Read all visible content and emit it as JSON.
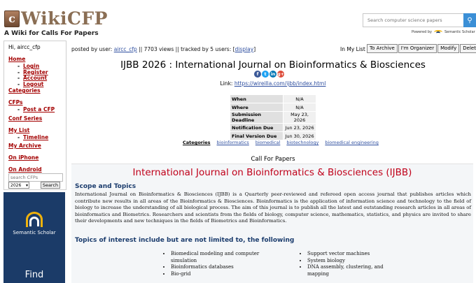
{
  "header": {
    "logo_mark": "c",
    "logo_text": "WikiCFP",
    "tagline": "A Wiki for Calls For Papers",
    "search_placeholder": "Search computer science papers",
    "search_icon": "search-icon",
    "powered_by": "Powered by",
    "powered_name": "Semantic Scholar"
  },
  "sidebar": {
    "greeting": "Hi, aircc_cfp",
    "home": "Home",
    "login": "Login",
    "register": "Register",
    "account": "Account",
    "logout": "Logout",
    "categories": "Categories",
    "cfps": "CFPs",
    "post_cfp": "Post a CFP",
    "conf_series": "Conf Series",
    "my_list": "My List",
    "timeline": "Timeline",
    "my_archive": "My Archive",
    "on_iphone": "On iPhone",
    "on_android": "On Android",
    "cfp_search_placeholder": "search CFPs",
    "year_selected": "2026",
    "search_button": "Search"
  },
  "ad": {
    "title": "Semantic Scholar",
    "cta": "Find"
  },
  "main": {
    "posted_prefix": "posted by user:",
    "posted_user": "aircc_cfp",
    "posted_stats": "|| 7703 views || tracked by 5 users: [",
    "display_link": "display",
    "posted_suffix": "]",
    "my_list_label": "In My List",
    "actions": [
      "To Archive",
      "I'm Organizer",
      "Modify",
      "Delete"
    ],
    "title": "IJBB 2026 : International Journal on Bioinformatics & Biosciences",
    "share_icons": [
      {
        "name": "facebook-icon",
        "glyph": "f",
        "color": "#3b5998"
      },
      {
        "name": "twitter-icon",
        "glyph": "t",
        "color": "#1da1f2"
      },
      {
        "name": "linkedin-icon",
        "glyph": "in",
        "color": "#0077b5"
      },
      {
        "name": "googleplus-icon",
        "glyph": "g+",
        "color": "#dd4b39"
      }
    ],
    "link_label": "Link:",
    "link_url": "https://wireilla.com/ijbb/index.html",
    "info": [
      {
        "key": "When",
        "value": "N/A"
      },
      {
        "key": "Where",
        "value": "N/A"
      },
      {
        "key": "Submission Deadline",
        "value": "May 23, 2026"
      },
      {
        "key": "Notification Due",
        "value": "Jun 23, 2026"
      },
      {
        "key": "Final Version Due",
        "value": "Jun 30, 2026"
      }
    ],
    "categories_label": "Categories",
    "categories": [
      "bioinformatics",
      "biomedical",
      "biotechnology",
      "biomedical engineering"
    ],
    "cfp_label": "Call For Papers",
    "journal_heading": "International Journal on Bioinformatics & Biosciences (IJBB)",
    "scope_heading": "Scope and Topics",
    "scope_body": "International Journal on Bioinformatics & Biosciences (IJBB) is a Quarterly peer-reviewed and refereed open access journal that publishes articles which contribute new results in all areas of the Bioinformatics & Biosciences. Bioinformatics is the application of information science and technology to the field of biology to increase the understanding of all biological process. The aim of this journal is to publish all the latest and outstanding research articles in all areas of bioinformatics and Biometrics. Researchers and scientists from the fields of biology, computer science, mathematics, statistics, and physics are invited to share their developments and new techniques in the fields of Biometrics and Bioinformatics.",
    "topics_heading": "Topics of interest include but are not limited to, the following",
    "topics_left": [
      "Biomedical modeling and computer simulation",
      "Bioinformatics databases",
      "Bio-grid"
    ],
    "topics_right": [
      "Support vector machines",
      "System biology",
      "DNA assembly, clustering, and mapping"
    ]
  }
}
